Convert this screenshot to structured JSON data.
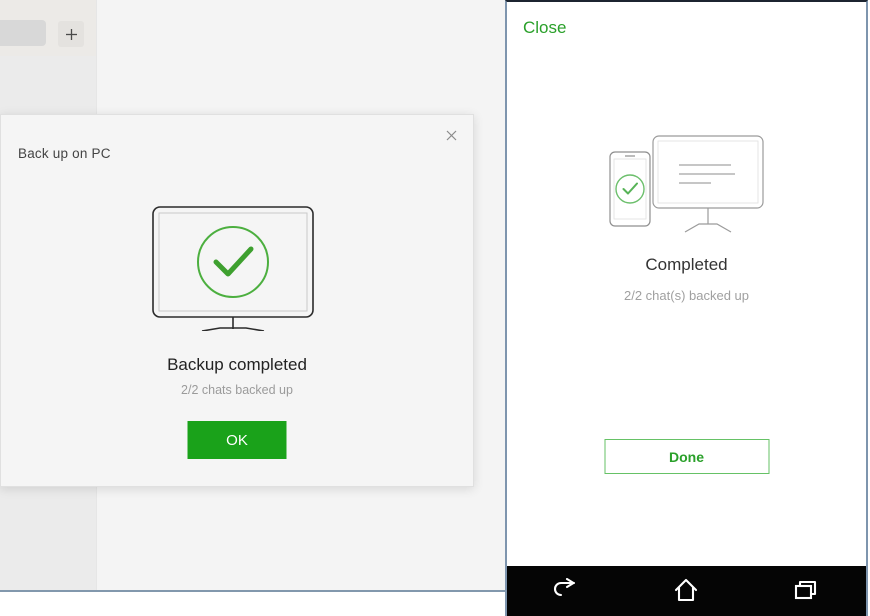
{
  "desktop": {
    "tabstrip": {
      "new_tab_label": "+",
      "new_tab_icon": "plus-icon"
    },
    "dialog": {
      "title": "Back up on PC",
      "close_label": "×",
      "close_icon": "close-icon",
      "illustration": "monitor-with-green-check-icon",
      "heading": "Backup completed",
      "subtitle": "2/2 chats backed up",
      "ok_label": "OK"
    }
  },
  "phone": {
    "close_label": "Close",
    "illustration": "phone-and-monitor-with-green-check-icon",
    "heading": "Completed",
    "subtitle": "2/2 chat(s) backed up",
    "done_label": "Done",
    "navbar": {
      "back_icon": "back-arrow-icon",
      "home_icon": "home-icon",
      "recents_icon": "recent-apps-icon"
    }
  },
  "colors": {
    "brand_green": "#1aa21a",
    "link_green": "#2aa02a",
    "outline_green": "#66c266",
    "dialog_bg": "#f5f5f5",
    "panel_border": "#7e95ae",
    "navbar_bg": "#050505"
  }
}
